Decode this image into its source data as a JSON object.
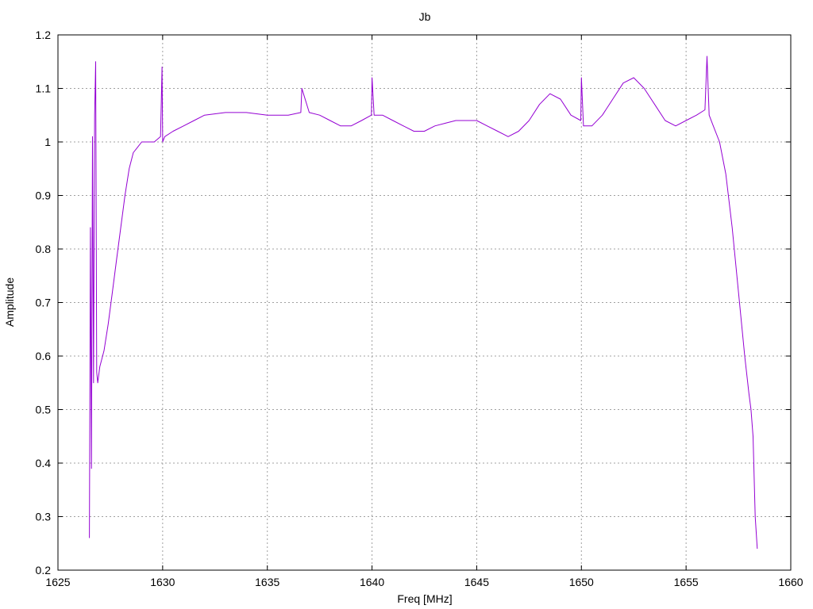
{
  "chart_data": {
    "type": "line",
    "title": "Jb",
    "xlabel": "Freq [MHz]",
    "ylabel": "Amplitude",
    "xlim": [
      1625,
      1660
    ],
    "ylim": [
      0.2,
      1.2
    ],
    "xticks": [
      1625,
      1630,
      1635,
      1640,
      1645,
      1650,
      1655,
      1660
    ],
    "yticks": [
      0.2,
      0.3,
      0.4,
      0.5,
      0.6,
      0.7,
      0.8,
      0.9,
      1,
      1.1,
      1.2
    ],
    "grid": true,
    "legend": "none",
    "series": [
      {
        "color": "#9400d3",
        "x": [
          1626.5,
          1626.55,
          1626.6,
          1626.65,
          1626.7,
          1626.75,
          1626.8,
          1626.85,
          1626.9,
          1627.0,
          1627.2,
          1627.4,
          1627.6,
          1627.8,
          1628.0,
          1628.2,
          1628.4,
          1628.6,
          1628.8,
          1629.0,
          1629.3,
          1629.6,
          1629.9,
          1629.97,
          1630.0,
          1630.1,
          1630.5,
          1631.0,
          1631.5,
          1632.0,
          1633.0,
          1634.0,
          1635.0,
          1636.0,
          1636.6,
          1636.65,
          1637.0,
          1637.5,
          1638.0,
          1638.5,
          1639.0,
          1639.5,
          1639.97,
          1640.0,
          1640.1,
          1640.5,
          1641.0,
          1641.5,
          1642.0,
          1642.5,
          1643.0,
          1643.5,
          1644.0,
          1644.5,
          1645.0,
          1645.5,
          1646.0,
          1646.5,
          1647.0,
          1647.5,
          1648.0,
          1648.5,
          1649.0,
          1649.5,
          1649.97,
          1650.0,
          1650.1,
          1650.5,
          1651.0,
          1651.5,
          1652.0,
          1652.5,
          1653.0,
          1653.5,
          1654.0,
          1654.5,
          1655.0,
          1655.5,
          1655.9,
          1656.0,
          1656.1,
          1656.3,
          1656.6,
          1656.9,
          1657.2,
          1657.5,
          1657.8,
          1658.0,
          1658.1,
          1658.2,
          1658.3,
          1658.4
        ],
        "y": [
          0.26,
          0.84,
          0.39,
          1.01,
          0.55,
          1.05,
          1.15,
          0.57,
          0.55,
          0.58,
          0.61,
          0.66,
          0.72,
          0.78,
          0.84,
          0.9,
          0.95,
          0.98,
          0.99,
          1.0,
          1.0,
          1.0,
          1.01,
          1.14,
          1.0,
          1.01,
          1.02,
          1.03,
          1.04,
          1.05,
          1.055,
          1.055,
          1.05,
          1.05,
          1.055,
          1.1,
          1.055,
          1.05,
          1.04,
          1.03,
          1.03,
          1.04,
          1.05,
          1.12,
          1.05,
          1.05,
          1.04,
          1.03,
          1.02,
          1.02,
          1.03,
          1.035,
          1.04,
          1.04,
          1.04,
          1.03,
          1.02,
          1.01,
          1.02,
          1.04,
          1.07,
          1.09,
          1.08,
          1.05,
          1.04,
          1.12,
          1.03,
          1.03,
          1.05,
          1.08,
          1.11,
          1.12,
          1.1,
          1.07,
          1.04,
          1.03,
          1.04,
          1.05,
          1.06,
          1.16,
          1.05,
          1.03,
          1.0,
          0.94,
          0.84,
          0.72,
          0.6,
          0.53,
          0.5,
          0.45,
          0.3,
          0.24
        ]
      }
    ]
  }
}
